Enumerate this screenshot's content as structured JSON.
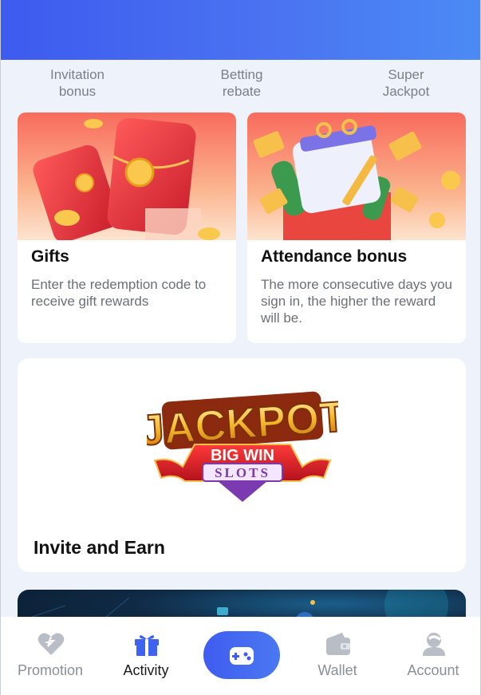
{
  "quick_links": [
    "Invitation\nbonus",
    "Betting\nrebate",
    "Super\nJackpot"
  ],
  "gifts": {
    "title": "Gifts",
    "desc": "Enter the redemption code to receive gift rewards"
  },
  "attendance": {
    "title": "Attendance bonus",
    "desc": "The more consecutive days you sign in, the higher the reward will be."
  },
  "invite": {
    "title": "Invite and Earn",
    "logo_text": {
      "line1": "JACKPOT",
      "line2": "BIG WIN",
      "line3": "SLOTS"
    }
  },
  "nav": {
    "items": [
      "Promotion",
      "Activity",
      "Wallet",
      "Account"
    ],
    "active": "Activity"
  },
  "colors": {
    "accent": "#3f5cf0",
    "page_bg": "#eef2fb",
    "muted_text": "#7a7f88"
  }
}
